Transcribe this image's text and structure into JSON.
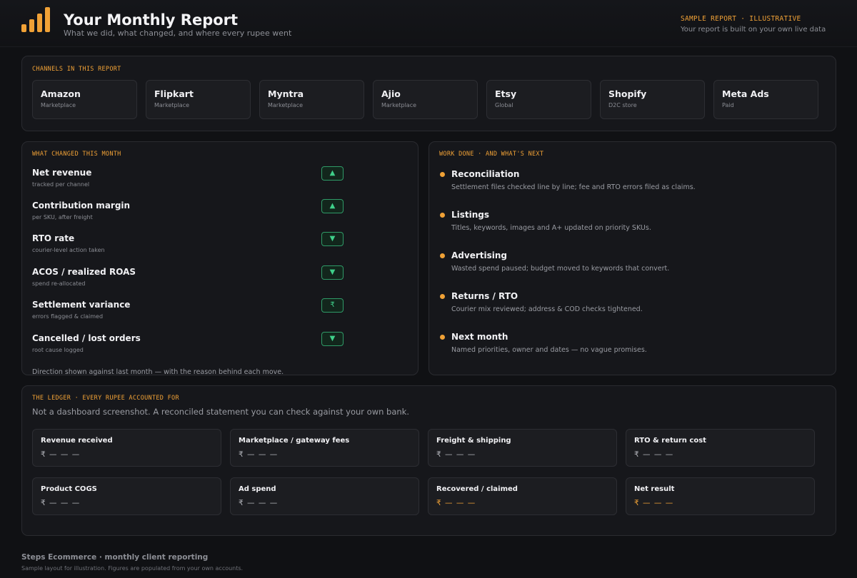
{
  "header": {
    "title": "Your Monthly Report",
    "subtitle": "What we did, what changed, and where every rupee went",
    "sample_tag": "SAMPLE REPORT · ILLUSTRATIVE",
    "sample_note": "Your report is built on your own live data",
    "logo_icon": "bar-chart-icon",
    "accent_color": "#f0a136"
  },
  "channels": {
    "kicker": "CHANNELS IN THIS REPORT",
    "items": [
      {
        "name": "Amazon",
        "type": "Marketplace"
      },
      {
        "name": "Flipkart",
        "type": "Marketplace"
      },
      {
        "name": "Myntra",
        "type": "Marketplace"
      },
      {
        "name": "Ajio",
        "type": "Marketplace"
      },
      {
        "name": "Etsy",
        "type": "Global"
      },
      {
        "name": "Shopify",
        "type": "D2C store"
      },
      {
        "name": "Meta Ads",
        "type": "Paid"
      }
    ]
  },
  "changes": {
    "kicker": "WHAT CHANGED THIS MONTH",
    "items": [
      {
        "label": "Net revenue",
        "sub": "tracked per channel",
        "badge": "▲",
        "badge_icon": "arrow-up-icon"
      },
      {
        "label": "Contribution margin",
        "sub": "per SKU, after freight",
        "badge": "▲",
        "badge_icon": "arrow-up-icon"
      },
      {
        "label": "RTO rate",
        "sub": "courier-level action taken",
        "badge": "▼",
        "badge_icon": "arrow-down-icon"
      },
      {
        "label": "ACOS / realized ROAS",
        "sub": "spend re-allocated",
        "badge": "▼",
        "badge_icon": "arrow-down-icon"
      },
      {
        "label": "Settlement variance",
        "sub": "errors flagged & claimed",
        "badge": "₹",
        "badge_icon": "rupee-icon"
      },
      {
        "label": "Cancelled / lost orders",
        "sub": "root cause logged",
        "badge": "▼",
        "badge_icon": "arrow-down-icon"
      }
    ],
    "footnote": "Direction shown against last month — with the reason behind each move.",
    "badge_color": "#3fd08a"
  },
  "work": {
    "kicker": "WORK DONE  ·  AND WHAT'S NEXT",
    "items": [
      {
        "label": "Reconciliation",
        "desc": "Settlement files checked line by line; fee and RTO errors filed as claims."
      },
      {
        "label": "Listings",
        "desc": "Titles, keywords, images and A+ updated on priority SKUs."
      },
      {
        "label": "Advertising",
        "desc": "Wasted spend paused; budget moved to keywords that convert."
      },
      {
        "label": "Returns / RTO",
        "desc": "Courier mix reviewed; address & COD checks tightened."
      },
      {
        "label": "Next month",
        "desc": "Named priorities, owner and dates — no vague promises."
      }
    ]
  },
  "ledger": {
    "kicker": "THE LEDGER  ·  EVERY RUPEE ACCOUNTED FOR",
    "desc": "Not a dashboard screenshot. A reconciled statement you can check against your own bank.",
    "items": [
      {
        "label": "Revenue received",
        "value": "₹ — — —"
      },
      {
        "label": "Marketplace / gateway fees",
        "value": "₹ — — —"
      },
      {
        "label": "Freight & shipping",
        "value": "₹ — — —"
      },
      {
        "label": "RTO & return cost",
        "value": "₹ — — —"
      },
      {
        "label": "Product COGS",
        "value": "₹ — — —"
      },
      {
        "label": "Ad spend",
        "value": "₹ — — —"
      },
      {
        "label": "Recovered / claimed",
        "value": "₹ — — —",
        "accent": true
      },
      {
        "label": "Net result",
        "value": "₹ — — —",
        "accent": true
      }
    ]
  },
  "footer": {
    "brand": "Steps Ecommerce · monthly client reporting",
    "note": "Sample layout for illustration. Figures are populated from your own accounts."
  }
}
